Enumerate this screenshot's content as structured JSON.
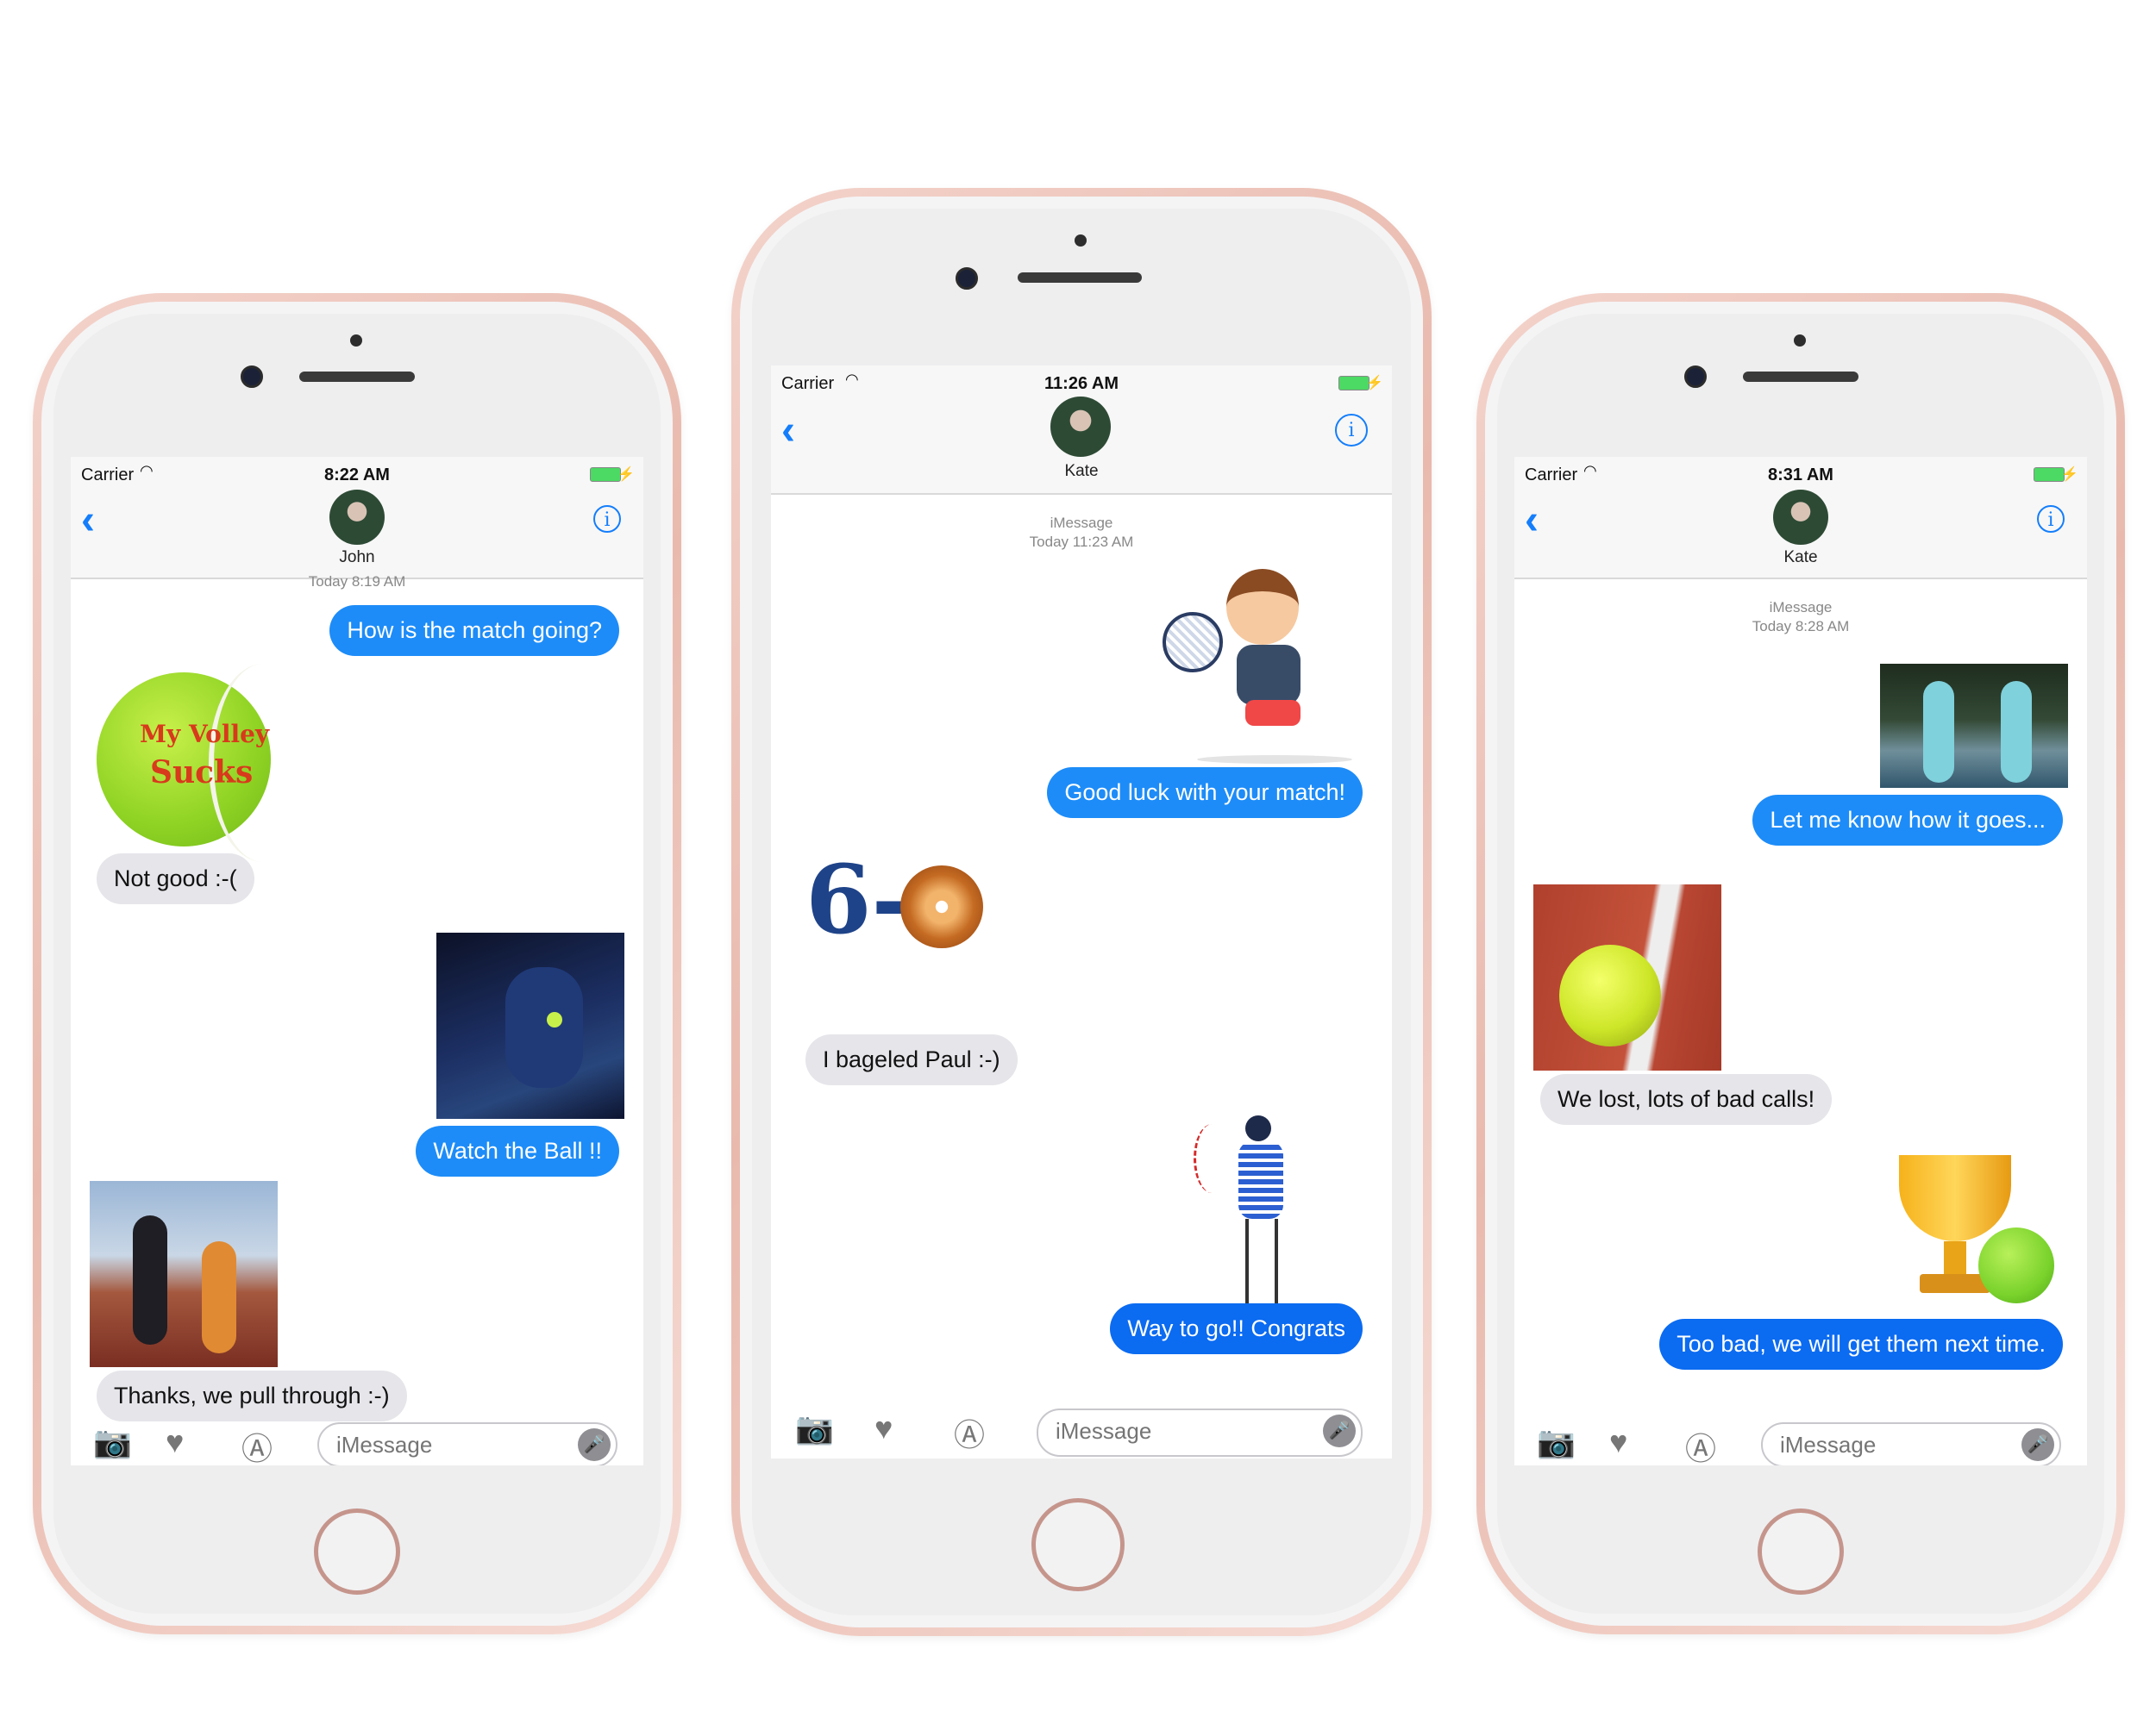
{
  "colors": {
    "bubble_out": "#1d8cf8",
    "bubble_out_dark": "#0b6bf1",
    "bubble_in": "#e5e5ea",
    "link": "#147efb",
    "battery": "#4cd964"
  },
  "icons": {
    "back": "chevron-left-icon",
    "info": "info-icon",
    "camera": "camera-icon",
    "digital_touch": "heart-icon",
    "apps": "app-store-icon",
    "mic": "microphone-icon",
    "wifi": "wifi-icon"
  },
  "phones": [
    {
      "carrier": "Carrier",
      "time": "8:22 AM",
      "contact": "John",
      "thread_header": "Today 8:19 AM",
      "messages": [
        "How is the match going?",
        "Not good :-(",
        "Watch the Ball !!",
        "Thanks, we pull through :-)"
      ],
      "sticker": {
        "line1": "My Volley",
        "line2": "Sucks"
      },
      "input_placeholder": "iMessage"
    },
    {
      "carrier": "Carrier",
      "time": "11:26 AM",
      "contact": "Kate",
      "service": "iMessage",
      "thread_header": "Today 11:23 AM",
      "messages": [
        "Good luck with your match!",
        "I bageled Paul :-)",
        "Way to go!! Congrats"
      ],
      "score_sticker": "6-",
      "input_placeholder": "iMessage"
    },
    {
      "carrier": "Carrier",
      "time": "8:31 AM",
      "contact": "Kate",
      "service": "iMessage",
      "thread_header": "Today 8:28 AM",
      "messages": [
        "Let me know how it goes...",
        "We lost, lots of bad calls!",
        "Too bad, we will get them next time."
      ],
      "input_placeholder": "iMessage"
    }
  ]
}
